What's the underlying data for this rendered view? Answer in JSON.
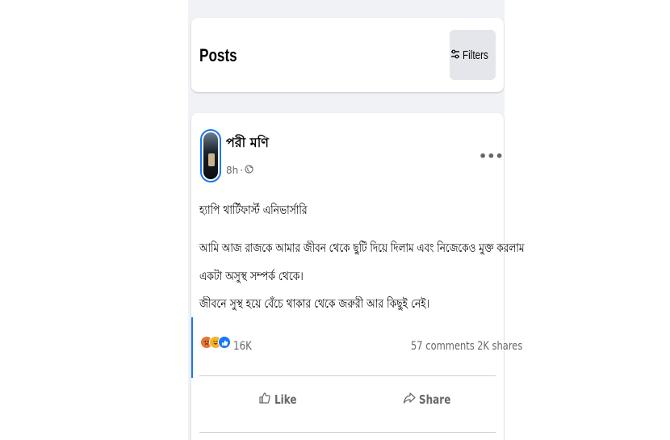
{
  "posts_header": {
    "title": "Posts",
    "filters_label": "Filters",
    "filters_icon": "sliders-icon"
  },
  "post": {
    "author": "পরী মণি",
    "time": "8h",
    "separator": "·",
    "audience_icon": "globe-icon",
    "more_label": "•••",
    "lines": [
      "হ্যাপি থার্টিফার্স্ট এনিভার্সারি",
      "আমি আজ রাজকে আমার জীবন থেকে ছুটি দিয়ে দিলাম এবং নিজেকেও মুক্ত করলাম",
      "একটা অসুস্থ সম্পর্ক থেকে।",
      "জীবনে সুস্থ হয়ে বেঁচে থাকার থেকে জরুরী আর কিছুই নেই।"
    ],
    "reactions": [
      "angry-icon",
      "haha-icon",
      "like-icon"
    ],
    "reaction_count": "16K",
    "comments": "57 comments",
    "shares": "2K shares",
    "like_label": "Like",
    "share_label": "Share"
  },
  "colors": {
    "accent": "#1877f2",
    "feed_background": "#f0f2f5",
    "secondary_text": "#65676b"
  }
}
